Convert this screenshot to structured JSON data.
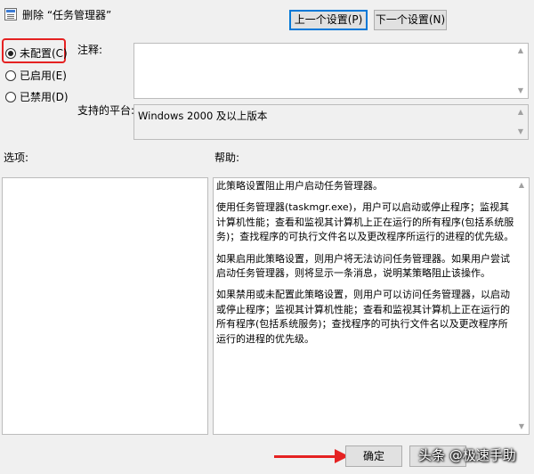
{
  "header": {
    "policy_title": "删除 “任务管理器”",
    "prev_button": "上一个设置(P)",
    "next_button": "下一个设置(N)"
  },
  "state_options": [
    {
      "label": "未配置(C)",
      "checked": true
    },
    {
      "label": "已启用(E)",
      "checked": false
    },
    {
      "label": "已禁用(D)",
      "checked": false
    }
  ],
  "comment": {
    "label": "注释:",
    "value": ""
  },
  "supported_on": {
    "label": "支持的平台:",
    "value": "Windows 2000 及以上版本"
  },
  "options": {
    "label": "选项:"
  },
  "help": {
    "label": "帮助:",
    "paragraphs": [
      "此策略设置阻止用户启动任务管理器。",
      "使用任务管理器(taskmgr.exe)，用户可以启动或停止程序；监视其计算机性能；查看和监视其计算机上正在运行的所有程序(包括系统服务)；查找程序的可执行文件名以及更改程序所运行的进程的优先级。",
      "如果启用此策略设置，则用户将无法访问任务管理器。如果用户尝试启动任务管理器，则将显示一条消息，说明某策略阻止该操作。",
      "如果禁用或未配置此策略设置，则用户可以访问任务管理器，以启动或停止程序；监视其计算机性能；查看和监视其计算机上正在运行的所有程序(包括系统服务)；查找程序的可执行文件名以及更改程序所运行的进程的优先级。"
    ]
  },
  "footer": {
    "ok_button": "确定",
    "cancel_button": ""
  },
  "watermark": "头条 @极速手助",
  "colors": {
    "highlight_red": "#e52222",
    "focus_blue": "#0078d7"
  }
}
